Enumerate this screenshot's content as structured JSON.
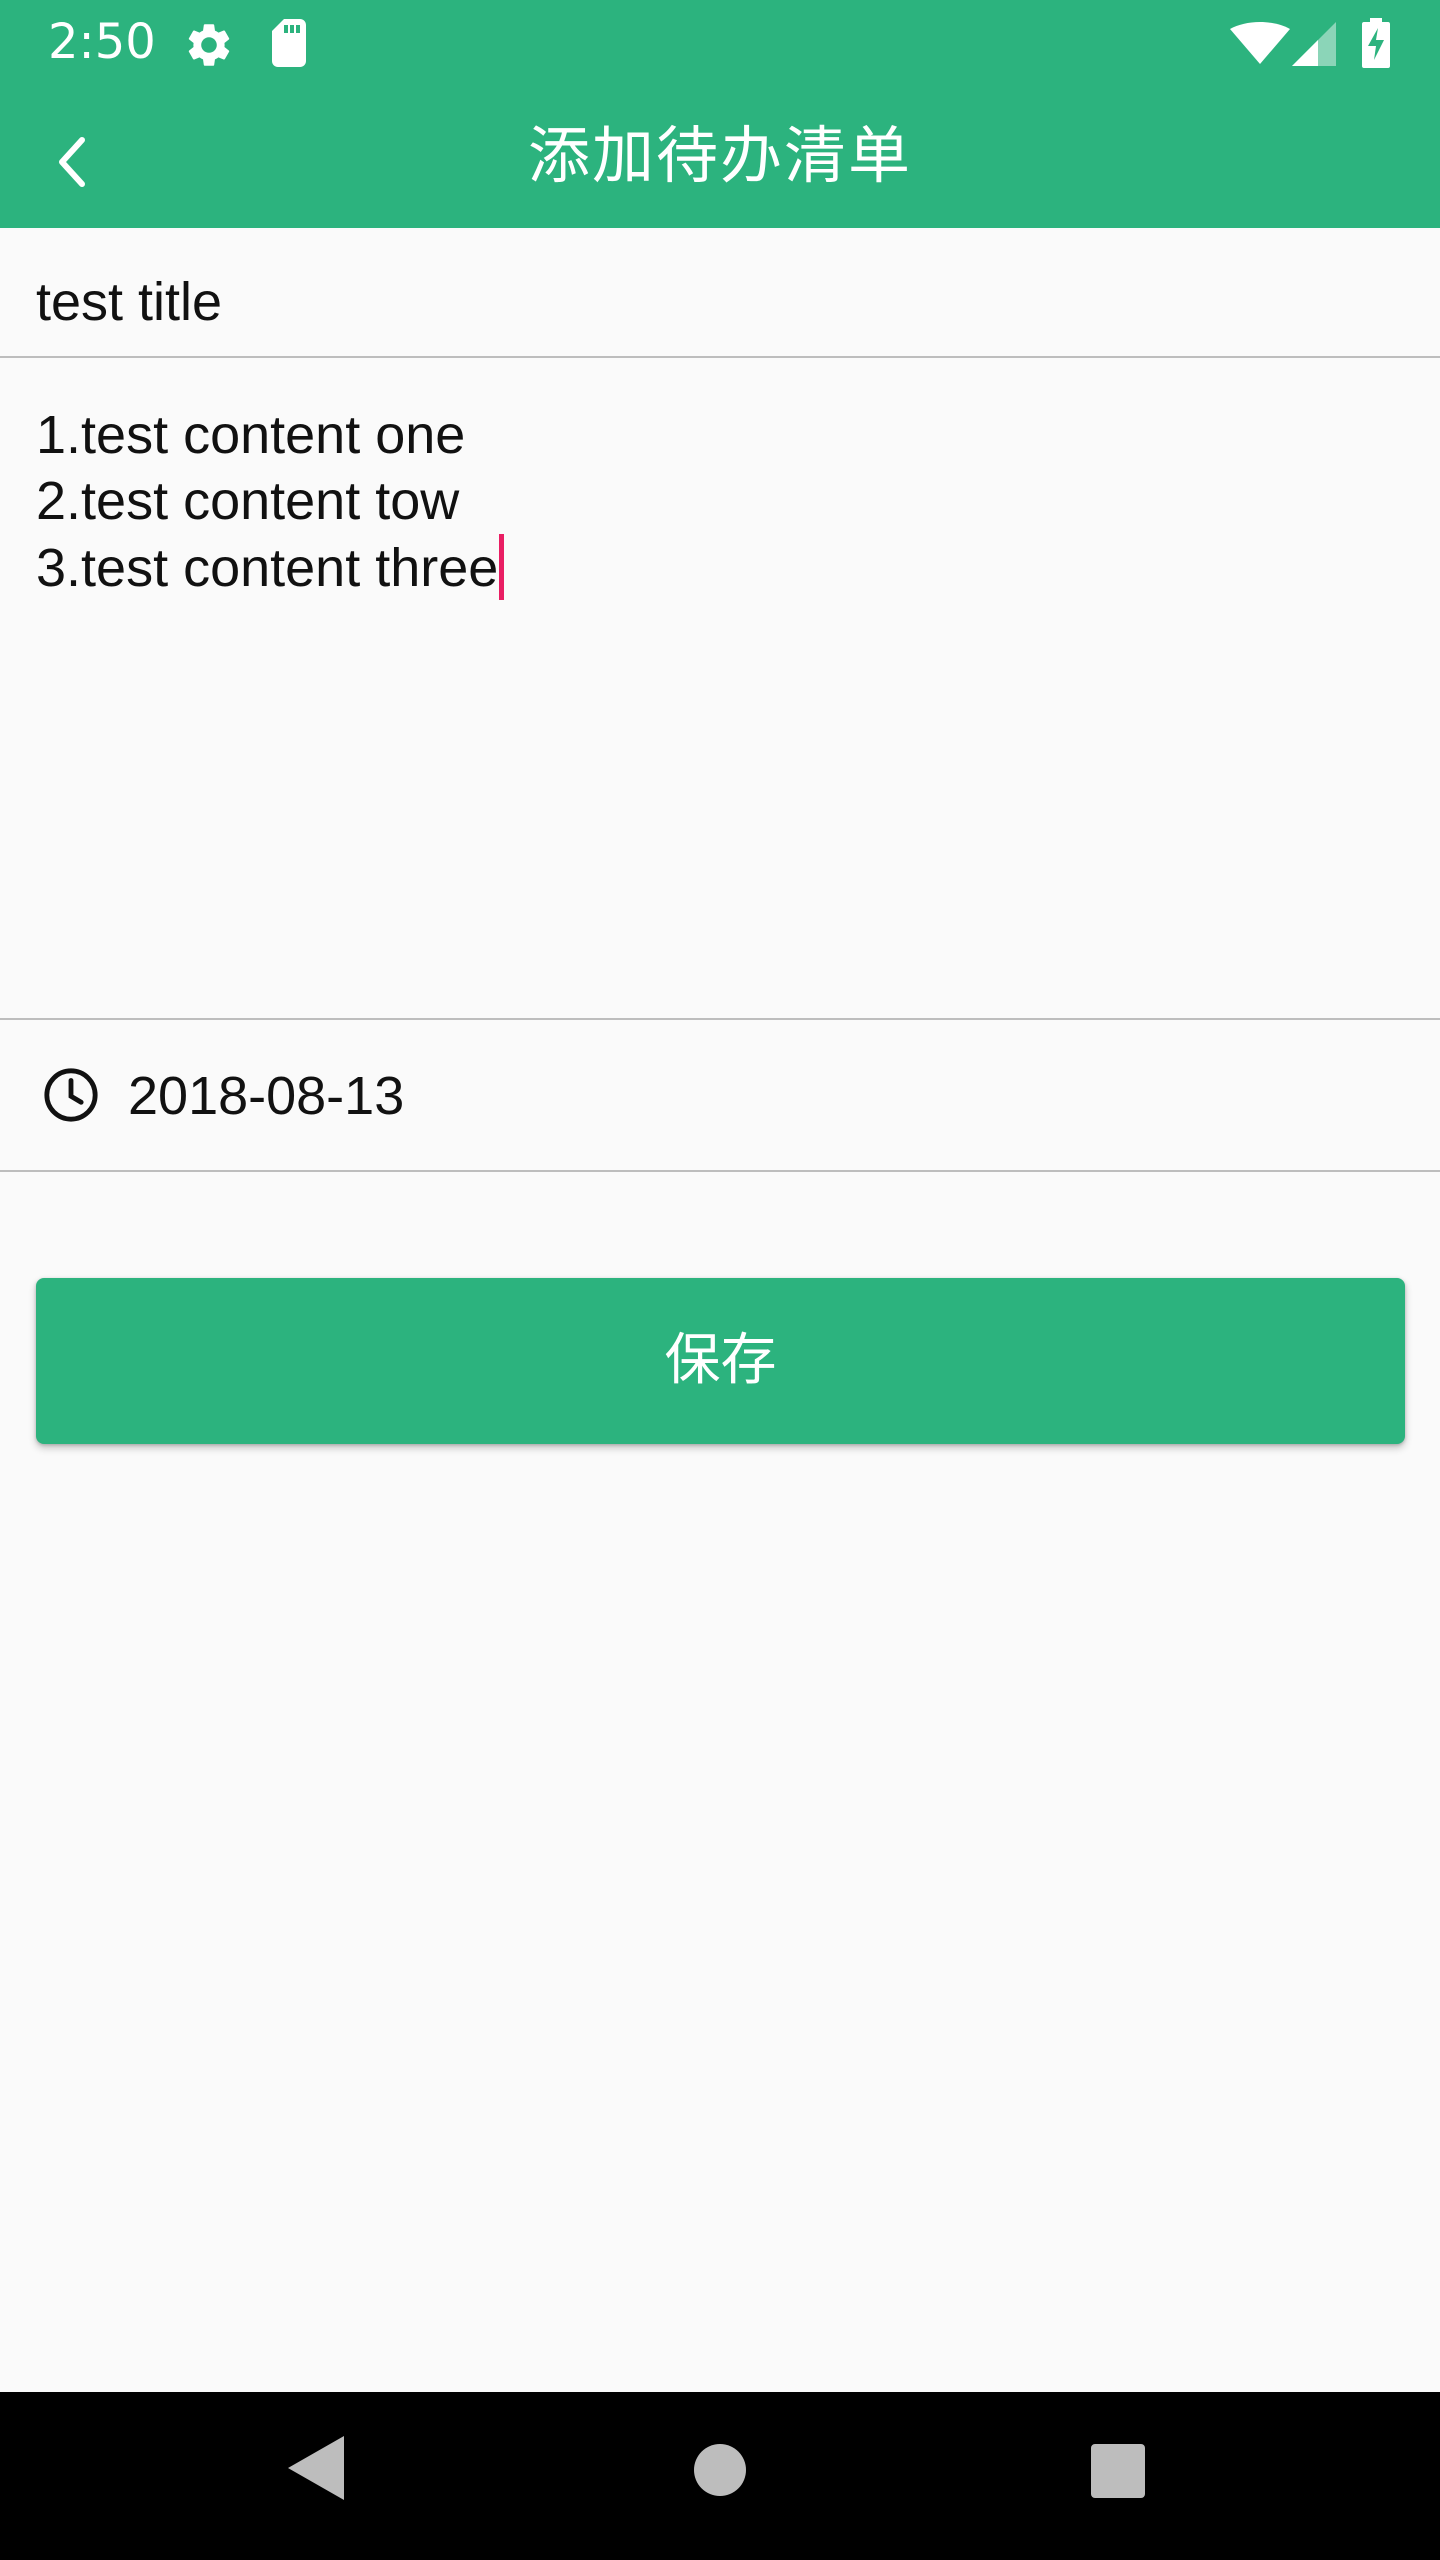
{
  "status_bar": {
    "time": "2:50",
    "icons": [
      "gear-icon",
      "sd-card-icon",
      "wifi-icon",
      "signal-icon",
      "battery-charging-icon"
    ]
  },
  "app_bar": {
    "title": "添加待办清单",
    "back_icon": "chevron-left-icon"
  },
  "form": {
    "title_value": "test title",
    "content_lines": [
      "1.test content one",
      "2.test content tow",
      "3.test content three"
    ],
    "date_icon": "clock-icon",
    "date": "2018-08-13",
    "save_label": "保存"
  },
  "nav_bar": {
    "icons": [
      "back-triangle-icon",
      "home-circle-icon",
      "recents-square-icon"
    ]
  },
  "colors": {
    "primary": "#2cb37e",
    "caret": "#e91e63",
    "background": "#fafafa",
    "divider": "#bdbdbd"
  }
}
